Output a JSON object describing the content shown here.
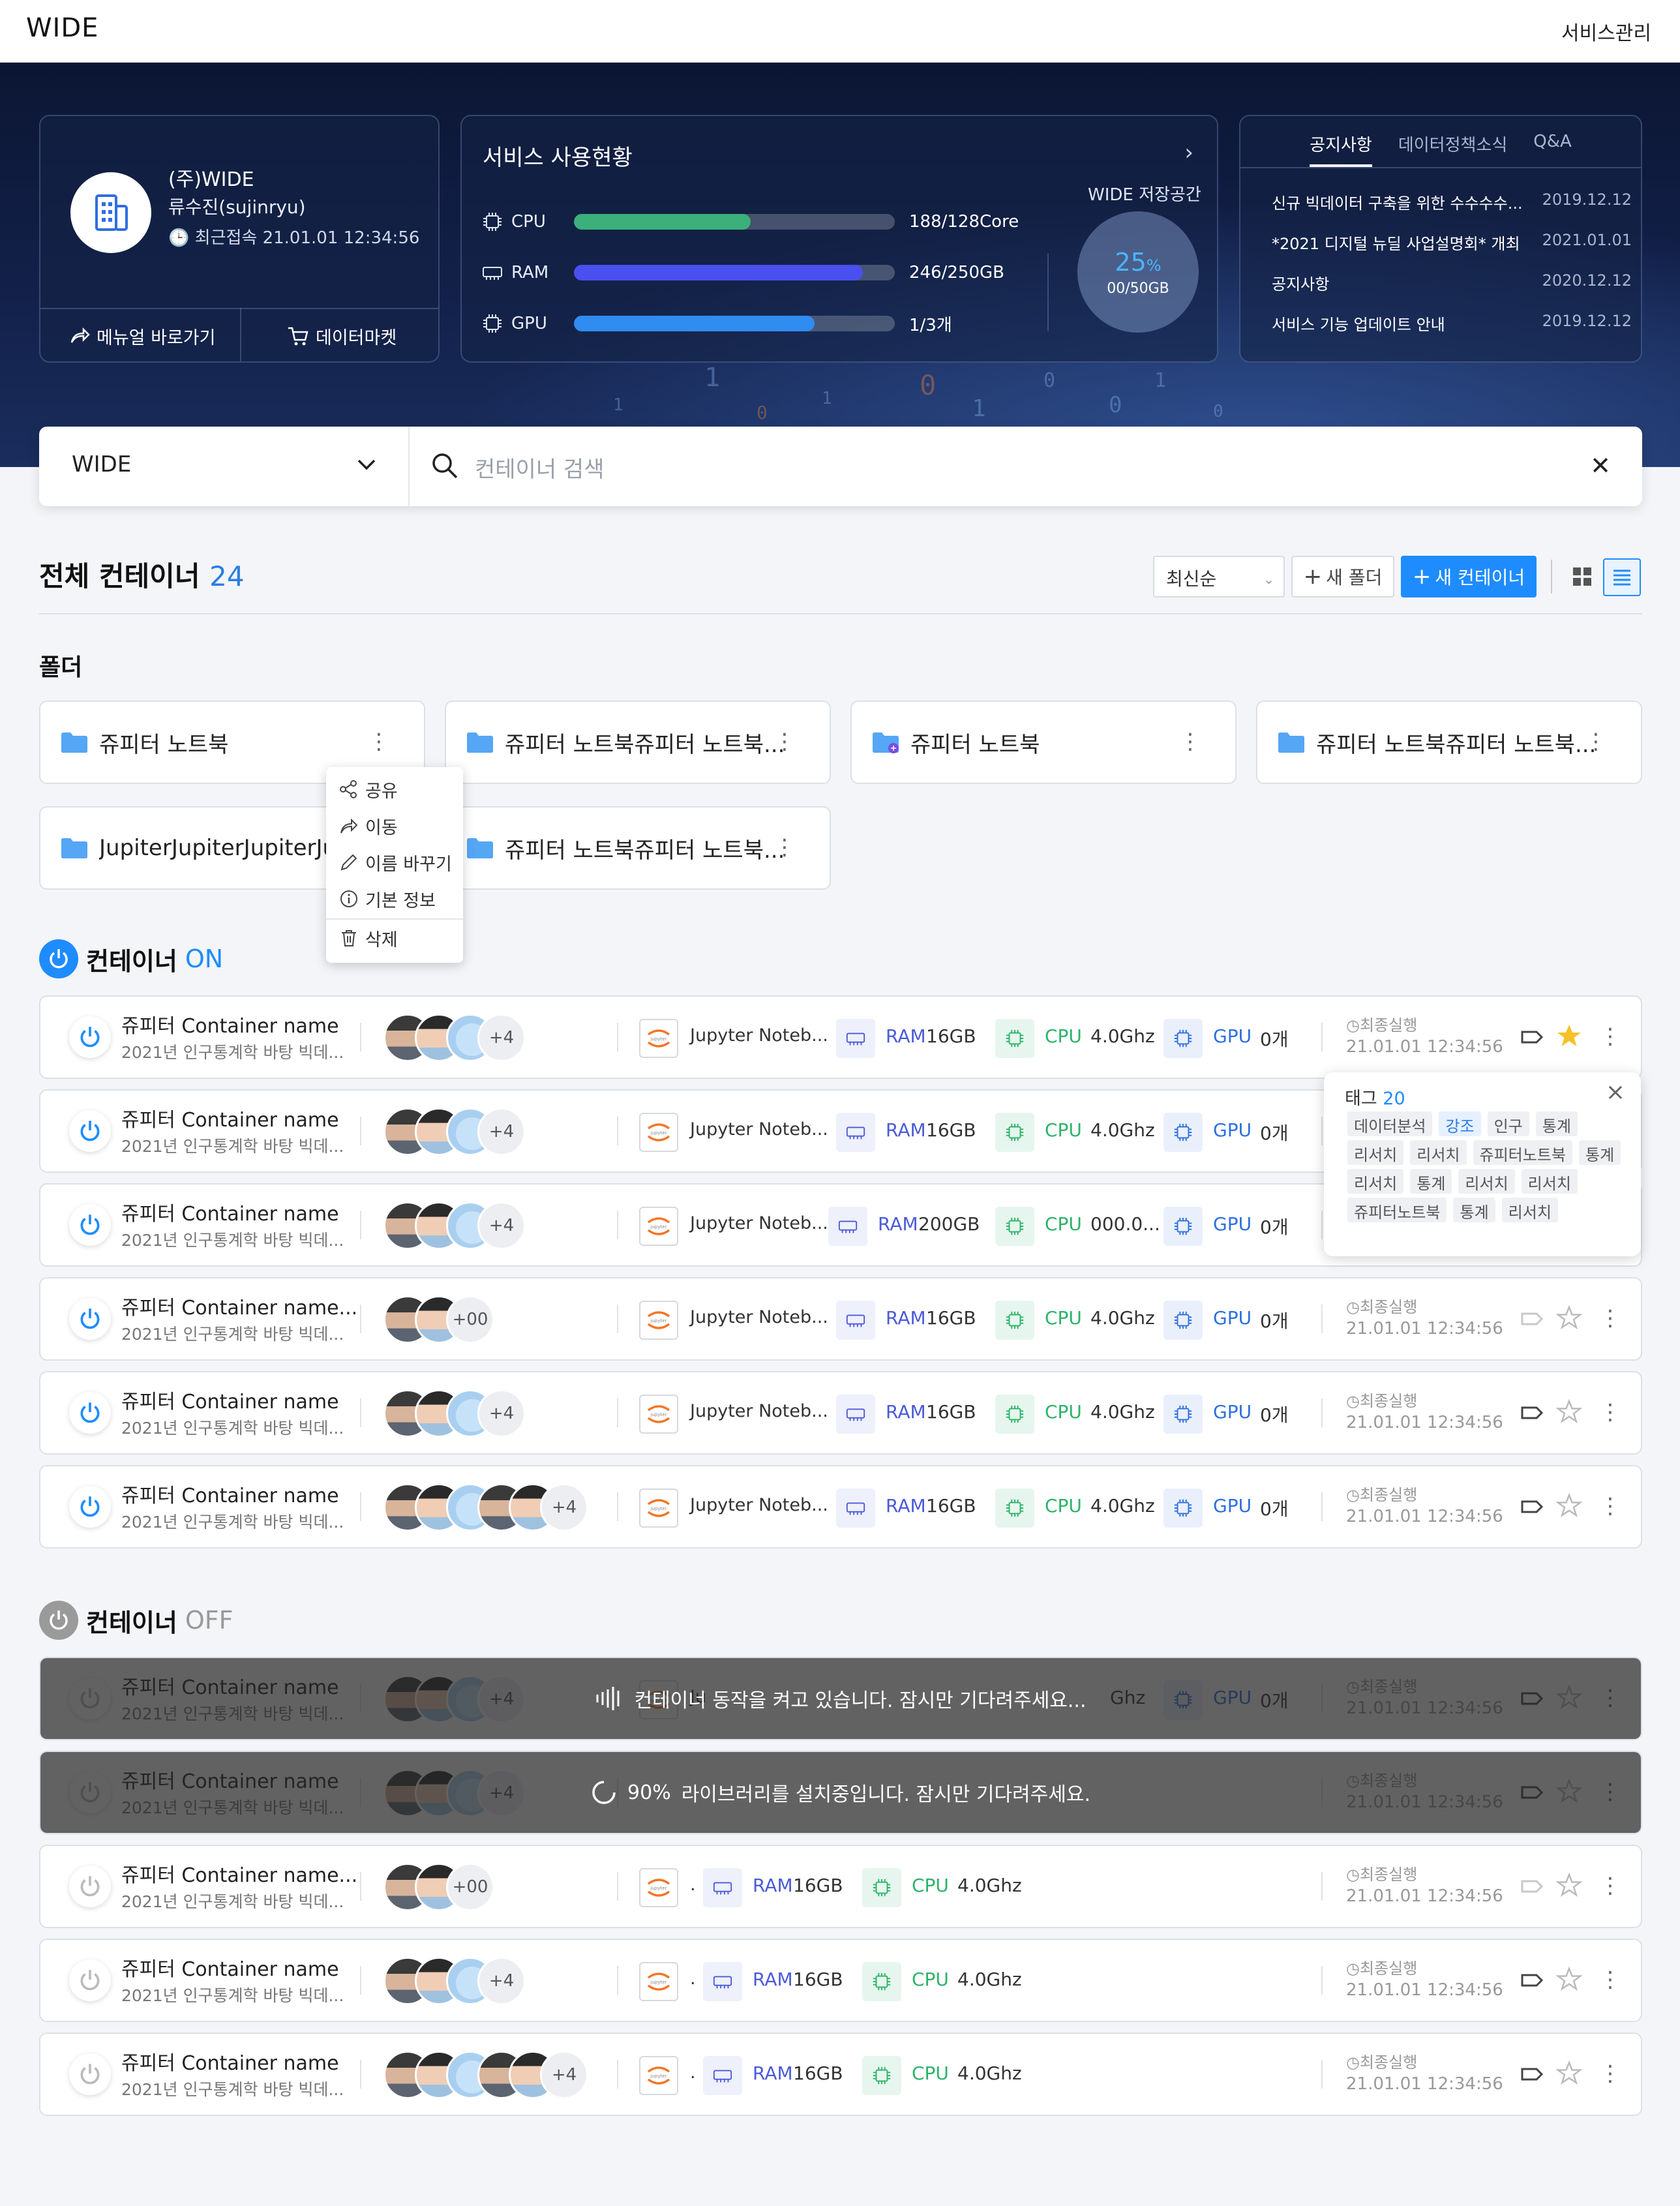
{
  "app": {
    "logo": "WIDE",
    "service_manage": "서비스관리"
  },
  "profile": {
    "org": "(주)WIDE",
    "user": "류수진(sujinryu)",
    "last_login": "최근접속 21.01.01 12:34:56",
    "manual_btn": "메뉴얼 바로가기",
    "market_btn": "데이터마켓"
  },
  "usage": {
    "title": "서비스 사용현황",
    "resources": [
      {
        "name": "CPU",
        "value": "188/128Core",
        "fraction": 0.55,
        "color": "#3bb07a"
      },
      {
        "name": "RAM",
        "value": "246/250GB",
        "fraction": 0.9,
        "color": "#4a4ff0"
      },
      {
        "name": "GPU",
        "value": "1/3개",
        "fraction": 0.75,
        "color": "#2f8cf0"
      }
    ],
    "storage_label": "WIDE 저장공간",
    "storage_pct": "25",
    "storage_pct_unit": "%",
    "storage_amount": "00/50GB"
  },
  "notice": {
    "tabs": [
      "공지사항",
      "데이터정책소식",
      "Q&A"
    ],
    "active_tab": 0,
    "items": [
      {
        "title": "신규 빅데이터 구축을 위한 수수수수...",
        "date": "2019.12.12"
      },
      {
        "title": "*2021 디지털 뉴딜 사업설명회* 개최",
        "date": "2021.01.01"
      },
      {
        "title": "공지사항",
        "date": "2020.12.12"
      },
      {
        "title": "서비스 기능 업데이트 안내",
        "date": "2019.12.12"
      }
    ]
  },
  "search": {
    "org": "WIDE",
    "placeholder": "컨테이너 검색"
  },
  "toolbar": {
    "title": "전체 컨테이너",
    "count": "24",
    "sort": "최신순",
    "new_folder": "새 폴더",
    "new_container": "새 컨테이너"
  },
  "folders": {
    "title": "폴더",
    "items": [
      {
        "name": "쥬피터 노트북"
      },
      {
        "name": "쥬피터 노트북쥬피터 노트북..."
      },
      {
        "name": "쥬피터 노트북",
        "shared": true
      },
      {
        "name": "쥬피터 노트북쥬피터 노트북..."
      },
      {
        "name": "JupiterJupiterJupiterJupiter"
      },
      {
        "name": "쥬피터 노트북쥬피터 노트북..."
      }
    ]
  },
  "context_menu": {
    "items": [
      "공유",
      "이동",
      "이름 바꾸기",
      "기본 정보",
      "삭제"
    ]
  },
  "groups": {
    "on": {
      "label": "컨테이너",
      "state": "ON",
      "color": "#1e8cff"
    },
    "off": {
      "label": "컨테이너",
      "state": "OFF",
      "color": "#999999"
    }
  },
  "containers_on": [
    {
      "name": "쥬피터 Container name",
      "desc": "2021년 인구통계학 바탕 빅데...",
      "avatars": 3,
      "more": "+4",
      "image": "Jupyter Noteb...",
      "ram_label": "RAM",
      "ram": "16GB",
      "cpu_label": "CPU",
      "cpu": "4.0Ghz",
      "gpu_label": "GPU",
      "gpu": "0개",
      "last_label": "최종실행",
      "last": "21.01.01 12:34:56",
      "tag_active": true,
      "starred": true
    },
    {
      "name": "쥬피터 Container name",
      "desc": "2021년 인구통계학 바탕 빅데...",
      "avatars": 3,
      "more": "+4",
      "image": "Jupyter Noteb...",
      "ram_label": "RAM",
      "ram": "16GB",
      "cpu_label": "CPU",
      "cpu": "4.0Ghz",
      "gpu_label": "GPU",
      "gpu": "0개",
      "last_label": "",
      "last": "",
      "tag_active": true,
      "starred": false
    },
    {
      "name": "쥬피터 Container name",
      "desc": "2021년 인구통계학 바탕 빅데...",
      "avatars": 3,
      "more": "+4",
      "image": "Jupyter Noteb...",
      "ram_label": "RAM",
      "ram": "200GB",
      "cpu_label": "CPU",
      "cpu": "000.0...",
      "gpu_label": "GPU",
      "gpu": "0개",
      "last_label": "",
      "last": "",
      "tag_active": true,
      "starred": false
    },
    {
      "name": "쥬피터 Container name...",
      "desc": "2021년 인구통계학 바탕 빅데...",
      "avatars": 2,
      "more": "+00",
      "image": "Jupyter Noteb...",
      "ram_label": "RAM",
      "ram": "16GB",
      "cpu_label": "CPU",
      "cpu": "4.0Ghz",
      "gpu_label": "GPU",
      "gpu": "0개",
      "last_label": "최종실행",
      "last": "21.01.01 12:34:56",
      "tag_active": false,
      "starred": false
    },
    {
      "name": "쥬피터 Container name",
      "desc": "2021년 인구통계학 바탕 빅데...",
      "avatars": 3,
      "more": "+4",
      "image": "Jupyter Noteb...",
      "ram_label": "RAM",
      "ram": "16GB",
      "cpu_label": "CPU",
      "cpu": "4.0Ghz",
      "gpu_label": "GPU",
      "gpu": "0개",
      "last_label": "최종실행",
      "last": "21.01.01 12:34:56",
      "tag_active": true,
      "starred": false
    },
    {
      "name": "쥬피터 Container name",
      "desc": "2021년 인구통계학 바탕 빅데...",
      "avatars": 5,
      "more": "+4",
      "image": "Jupyter Noteb...",
      "ram_label": "RAM",
      "ram": "16GB",
      "cpu_label": "CPU",
      "cpu": "4.0Ghz",
      "gpu_label": "GPU",
      "gpu": "0개",
      "last_label": "최종실행",
      "last": "21.01.01 12:34:56",
      "tag_active": true,
      "starred": false
    }
  ],
  "containers_off": [
    {
      "name": "쥬피터 Container name",
      "desc": "2021년 인구통계학 바탕 빅데...",
      "avatars": 3,
      "more": "+4",
      "image": "Ju",
      "ram_label": "",
      "ram": "",
      "cpu_label": "",
      "cpu": "Ghz",
      "gpu_label": "GPU",
      "gpu": "0개",
      "last_label": "최종실행",
      "last": "21.01.01 12:34:56",
      "tag_active": true,
      "starred": false,
      "overlay": {
        "text": "컨테이너 동작을 켜고 있습니다. 잠시만 기다려주세요...",
        "icon": "loading-bars-icon"
      }
    },
    {
      "name": "쥬피터 Container name",
      "desc": "2021년 인구통계학 바탕 빅데...",
      "avatars": 3,
      "more": "+4",
      "image": "",
      "ram_label": "",
      "ram": "",
      "cpu_label": "",
      "cpu": "",
      "gpu_label": "",
      "gpu": "",
      "last_label": "최종실행",
      "last": "21.01.01 12:34:56",
      "tag_active": true,
      "starred": false,
      "overlay": {
        "percent": "90%",
        "text": "라이브러리를 설치중입니다. 잠시만 기다려주세요.",
        "icon": "spinner-icon"
      }
    },
    {
      "name": "쥬피터 Container name...",
      "desc": "2021년 인구통계학 바탕 빅데...",
      "avatars": 2,
      "more": "+00",
      "image": ".",
      "ram_label": "RAM",
      "ram": "16GB",
      "cpu_label": "CPU",
      "cpu": "4.0Ghz",
      "gpu_label": "",
      "gpu": "",
      "last_label": "최종실행",
      "last": "21.01.01 12:34:56",
      "tag_active": false,
      "starred": false
    },
    {
      "name": "쥬피터 Container name",
      "desc": "2021년 인구통계학 바탕 빅데...",
      "avatars": 3,
      "more": "+4",
      "image": ".",
      "ram_label": "RAM",
      "ram": "16GB",
      "cpu_label": "CPU",
      "cpu": "4.0Ghz",
      "gpu_label": "",
      "gpu": "",
      "last_label": "최종실행",
      "last": "21.01.01 12:34:56",
      "tag_active": true,
      "starred": false
    },
    {
      "name": "쥬피터 Container name",
      "desc": "2021년 인구통계학 바탕 빅데...",
      "avatars": 5,
      "more": "+4",
      "image": ".",
      "ram_label": "RAM",
      "ram": "16GB",
      "cpu_label": "CPU",
      "cpu": "4.0Ghz",
      "gpu_label": "",
      "gpu": "",
      "last_label": "최종실행",
      "last": "21.01.01 12:34:56",
      "tag_active": true,
      "starred": false
    }
  ],
  "tag_popup": {
    "title": "태그",
    "count": "20",
    "tags": [
      "데이터분석",
      "강조",
      "인구",
      "통계",
      "리서치",
      "리서치",
      "쥬피터노트북",
      "통계",
      "리서치",
      "통계",
      "리서치",
      "리서치",
      "쥬피터노트북",
      "통계",
      "리서치"
    ],
    "highlighted": [
      1
    ]
  },
  "colors": {
    "accent": "#1e8cff",
    "star": "#f6c125",
    "ram": "#4a5bd8",
    "cpu": "#2cb36a",
    "gpu": "#2e6fe0"
  }
}
